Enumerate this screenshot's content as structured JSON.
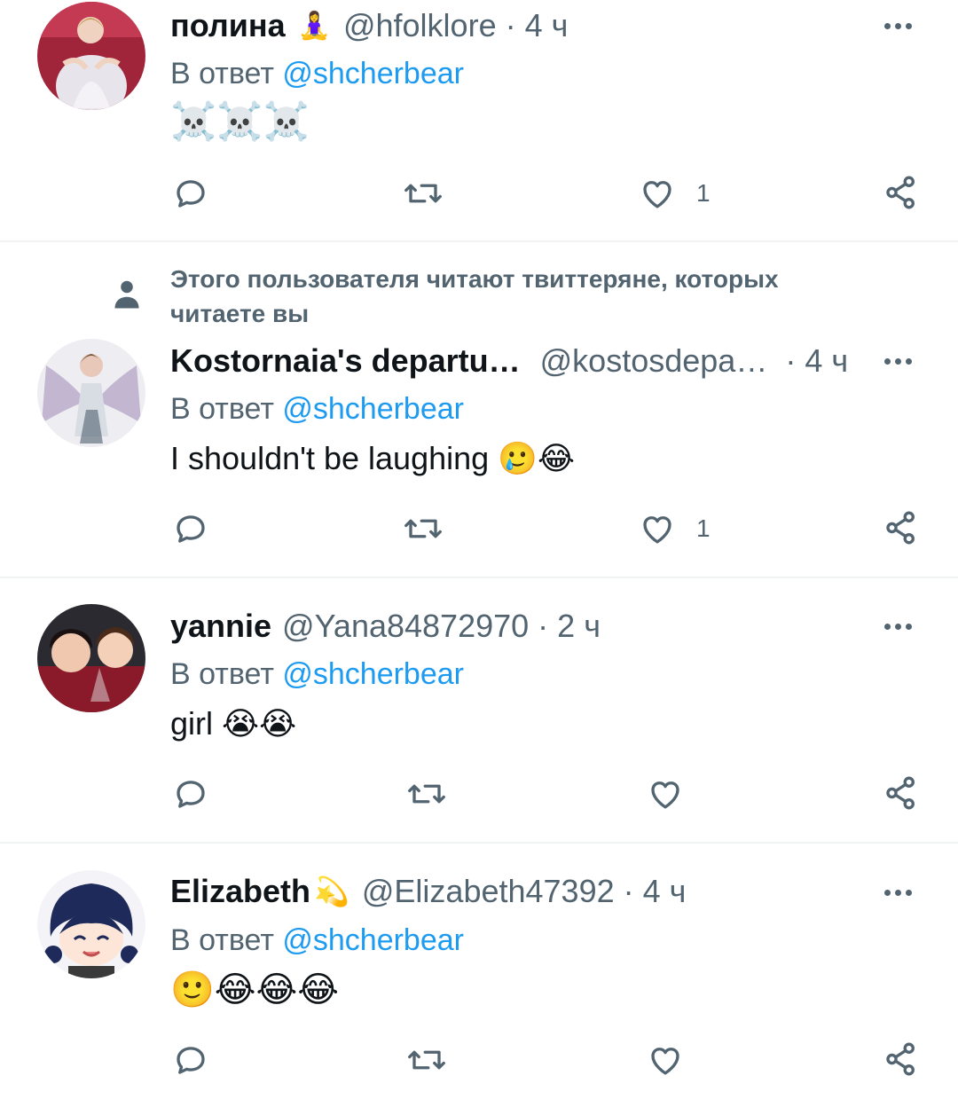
{
  "reply_prefix": "В ответ",
  "tweets": [
    {
      "name": "полина",
      "name_emoji": "🧘‍♀️",
      "handle": "@hfolklore",
      "time": "4 ч",
      "reply_to": "@shcherbear",
      "text": "☠️☠️☠️",
      "likes": "1"
    },
    {
      "social_context": "Этого пользователя читают твиттеряне, которых читаете вы",
      "name": "Kostornaia's departu…",
      "handle": "@kostosdepa…",
      "time": "4 ч",
      "reply_to": "@shcherbear",
      "text": "I shouldn't be laughing",
      "text_emoji": "🥲😂",
      "likes": "1"
    },
    {
      "name": "yannie",
      "handle": "@Yana84872970",
      "time": "2 ч",
      "reply_to": "@shcherbear",
      "text": "girl",
      "text_emoji": "😭😭",
      "likes": ""
    },
    {
      "name": "Elizabeth",
      "name_emoji": "💫",
      "handle": "@Elizabeth47392",
      "time": "4 ч",
      "reply_to": "@shcherbear",
      "text": "🙂😂😂😂",
      "likes": ""
    }
  ],
  "colors": {
    "text": "#0f1419",
    "secondary": "#536471",
    "accent": "#1d9bf0",
    "divider": "#eff3f4"
  },
  "icons": [
    "reply-icon",
    "retweet-icon",
    "like-icon",
    "share-icon",
    "more-icon",
    "person-icon"
  ]
}
